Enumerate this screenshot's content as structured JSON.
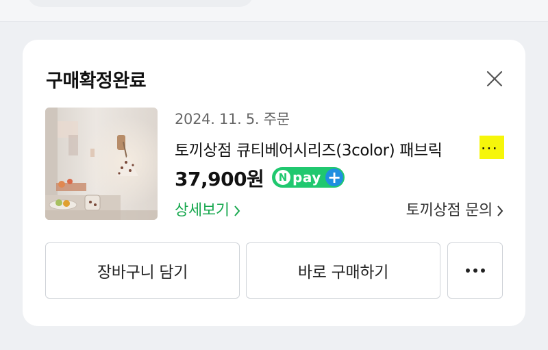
{
  "order_card": {
    "status_title": "구매확정완료",
    "order_date": "2024. 11. 5. 주문",
    "product_name": "토끼상점 큐티베어시리즈(3color) 패브릭",
    "ellipsis": "...",
    "price": "37,900원",
    "npay_badge": {
      "n_letter": "N",
      "text": "pay",
      "plus": "+"
    },
    "detail_link": "상세보기",
    "seller_inquiry_link": "토끼상점 문의",
    "buttons": {
      "add_to_cart": "장바구니 담기",
      "buy_now": "바로 구매하기"
    },
    "icons": {
      "close": "close-icon",
      "more": "more-horizontal-icon",
      "chevron": "chevron-right-icon"
    },
    "colors": {
      "link_green": "#18a84f",
      "npay_green": "#20c86f",
      "npay_plus_blue": "#1f8fe0",
      "highlight_yellow": "#f6f60a"
    }
  }
}
